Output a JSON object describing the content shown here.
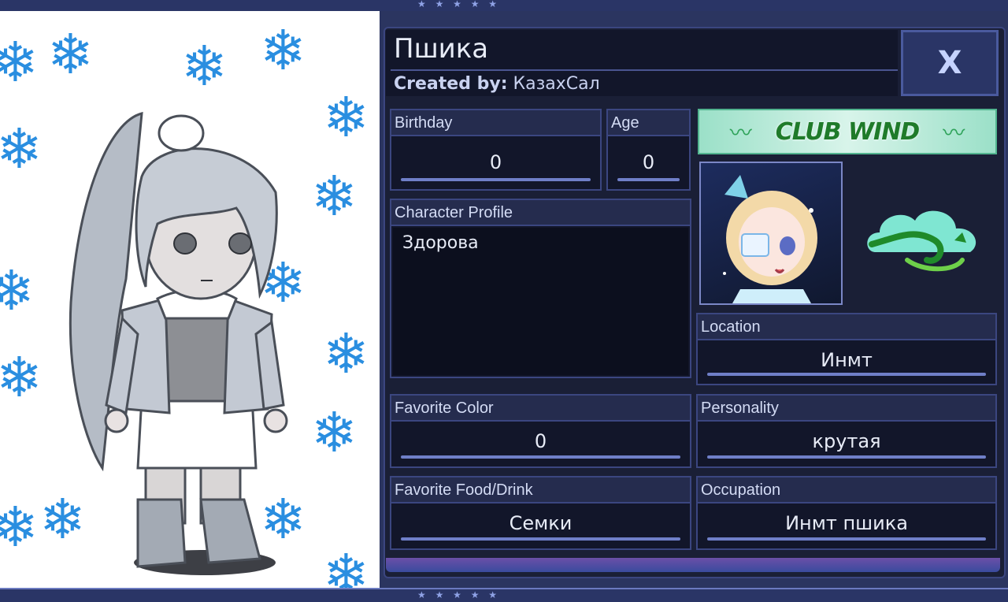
{
  "header": {
    "character_name": "Пшика",
    "created_by_label": "Created by:",
    "creator_name": "КазахСал",
    "close_label": "X"
  },
  "fields": {
    "birthday": {
      "label": "Birthday",
      "value": "0"
    },
    "age": {
      "label": "Age",
      "value": "0"
    },
    "profile": {
      "label": "Character Profile",
      "value": "Здорова"
    },
    "favorite_color": {
      "label": "Favorite Color",
      "value": "0"
    },
    "favorite_food": {
      "label": "Favorite Food/Drink",
      "value": "Семки"
    },
    "location": {
      "label": "Location",
      "value": "Инмт"
    },
    "personality": {
      "label": "Personality",
      "value": "крутая"
    },
    "occupation": {
      "label": "Occupation",
      "value": "Инмт пшика"
    }
  },
  "club": {
    "name": "CLUB WIND"
  },
  "colors": {
    "panel_bg": "#1a1f36",
    "field_label_bg": "#252c4e",
    "snowflake": "#2a8ee0",
    "club_text": "#1f7b2a"
  },
  "icons": [
    "snowflake-icon",
    "close-icon",
    "wind-cloud-icon"
  ]
}
